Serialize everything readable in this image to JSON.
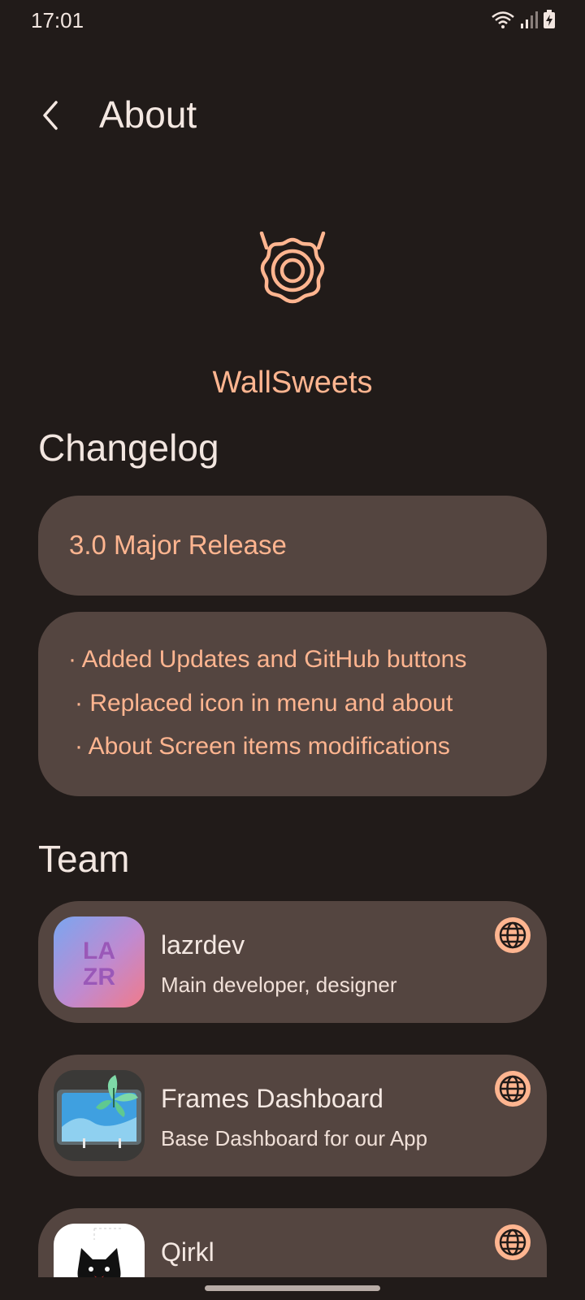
{
  "status_bar": {
    "time": "17:01",
    "icons": [
      "wifi-icon",
      "signal-icon",
      "battery-charging-icon"
    ]
  },
  "header": {
    "back_icon": "chevron-left-icon",
    "title": "About"
  },
  "app": {
    "logo_icon": "donut-logo-icon",
    "name": "WallSweets",
    "accent_color": "#ffb590"
  },
  "changelog": {
    "heading": "Changelog",
    "release_title": "3.0 Major Release",
    "items": [
      "· Added Updates and GitHub buttons",
      "· Replaced icon in menu and about",
      "· About Screen items modifications"
    ]
  },
  "team": {
    "heading": "Team",
    "members": [
      {
        "name": "lazrdev",
        "role": "Main developer, designer",
        "avatar": "lazr-logo",
        "avatar_text": [
          "LA",
          "ZR"
        ],
        "link_icon": "globe-icon"
      },
      {
        "name": "Frames Dashboard",
        "role": "Base Dashboard for our App",
        "avatar": "frames-dashboard-logo",
        "link_icon": "globe-icon"
      },
      {
        "name": "Qirkl",
        "role": "",
        "avatar": "qirkl-cat-logo",
        "link_icon": "globe-icon"
      }
    ]
  },
  "colors": {
    "background": "#211b19",
    "card": "#544540",
    "accent": "#ffb590"
  }
}
